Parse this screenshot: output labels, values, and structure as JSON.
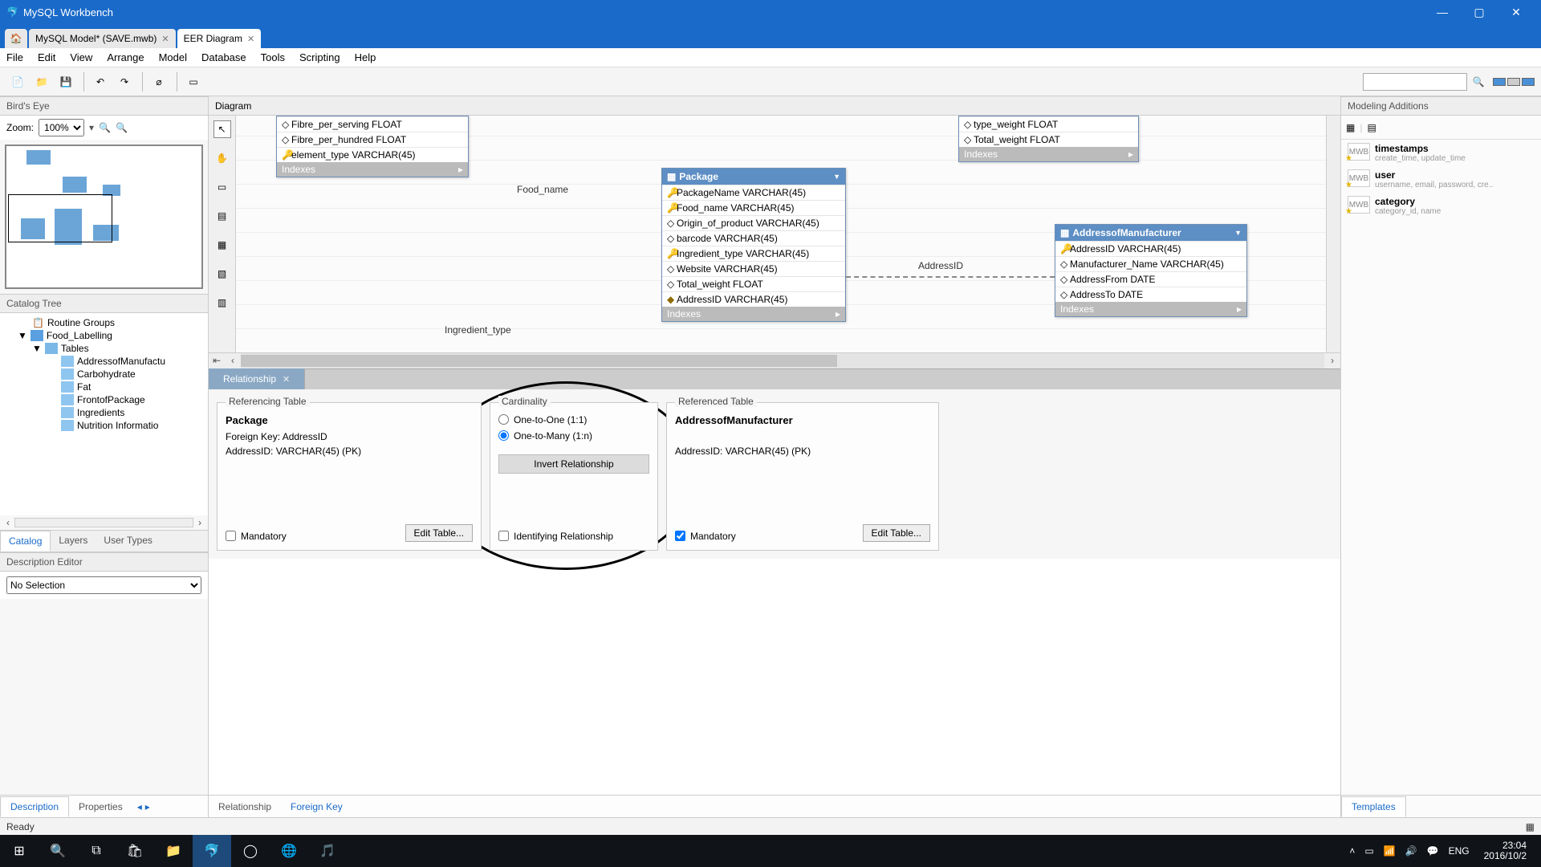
{
  "window": {
    "title": "MySQL Workbench"
  },
  "tabs": [
    {
      "label": "MySQL Model* (SAVE.mwb)",
      "active": false
    },
    {
      "label": "EER Diagram",
      "active": true
    }
  ],
  "menu": [
    "File",
    "Edit",
    "View",
    "Arrange",
    "Model",
    "Database",
    "Tools",
    "Scripting",
    "Help"
  ],
  "left": {
    "birds_eye": "Bird's Eye",
    "zoom_label": "Zoom:",
    "zoom_value": "100%",
    "catalog": "Catalog Tree",
    "tree": {
      "routine_groups": "Routine Groups",
      "schema": "Food_Labelling",
      "tables_label": "Tables",
      "tables": [
        "AddressofManufactu",
        "Carbohydrate",
        "Fat",
        "FrontofPackage",
        "Ingredients",
        "Nutrition Informatio"
      ]
    },
    "tabs": [
      "Catalog",
      "Layers",
      "User Types"
    ],
    "desc_editor": "Description Editor",
    "desc_value": "No Selection"
  },
  "diagram": {
    "header": "Diagram",
    "labels": {
      "food_name": "Food_name",
      "ingredient_type": "Ingredient_type",
      "address_id": "AddressID"
    },
    "t_left": {
      "rows": [
        "Fibre_per_serving FLOAT",
        "Fibre_per_hundred FLOAT",
        "element_type VARCHAR(45)"
      ],
      "idx": "Indexes"
    },
    "t_right_top": {
      "rows": [
        "type_weight FLOAT",
        "Total_weight FLOAT"
      ],
      "idx": "Indexes"
    },
    "package": {
      "title": "Package",
      "rows": [
        "PackageName VARCHAR(45)",
        "Food_name VARCHAR(45)",
        "Origin_of_product VARCHAR(45)",
        "barcode VARCHAR(45)",
        "Ingredient_type VARCHAR(45)",
        "Website VARCHAR(45)",
        "Total_weight FLOAT",
        "AddressID VARCHAR(45)"
      ],
      "idx": "Indexes"
    },
    "addr": {
      "title": "AddressofManufacturer",
      "rows": [
        "AddressID VARCHAR(45)",
        "Manufacturer_Name VARCHAR(45)",
        "AddressFrom DATE",
        "AddressTo DATE"
      ],
      "idx": "Indexes"
    }
  },
  "rel_tab": {
    "label": "Relationship"
  },
  "rel": {
    "referencing": {
      "legend": "Referencing Table",
      "table": "Package",
      "fk": "Foreign Key: AddressID",
      "col": "AddressID: VARCHAR(45) (PK)",
      "mandatory": "Mandatory",
      "edit": "Edit Table..."
    },
    "cardinality": {
      "legend": "Cardinality",
      "one_one": "One-to-One (1:1)",
      "one_many": "One-to-Many (1:n)",
      "invert": "Invert Relationship",
      "identifying": "Identifying Relationship"
    },
    "referenced": {
      "legend": "Referenced Table",
      "table": "AddressofManufacturer",
      "col": "AddressID: VARCHAR(45) (PK)",
      "mandatory": "Mandatory",
      "edit": "Edit Table..."
    }
  },
  "bottom_tabs_left": [
    "Description",
    "Properties"
  ],
  "bottom_tabs_right": [
    "Relationship",
    "Foreign Key"
  ],
  "right": {
    "header": "Modeling Additions",
    "items": [
      {
        "t1": "timestamps",
        "t2": "create_time, update_time"
      },
      {
        "t1": "user",
        "t2": "username, email, password, cre.."
      },
      {
        "t1": "category",
        "t2": "category_id, name"
      }
    ],
    "templates": "Templates"
  },
  "status": {
    "ready": "Ready"
  },
  "taskbar": {
    "lang": "ENG",
    "time": "23:04",
    "date": "2016/10/2"
  }
}
